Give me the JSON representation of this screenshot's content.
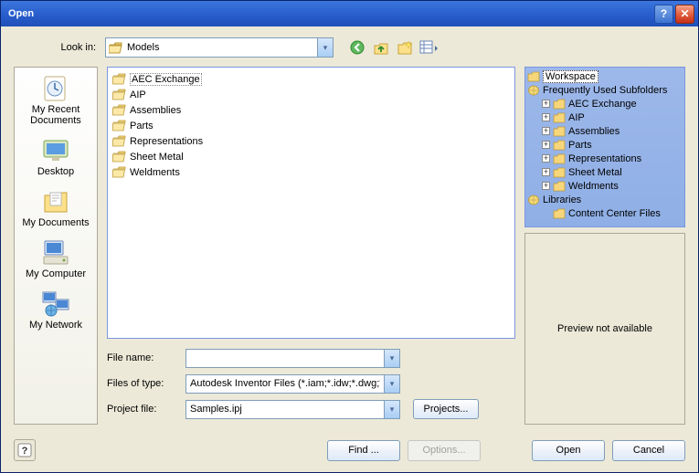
{
  "window": {
    "title": "Open"
  },
  "lookIn": {
    "label": "Look in:",
    "value": "Models"
  },
  "fileList": [
    {
      "name": "AEC Exchange",
      "selected": true
    },
    {
      "name": "AIP"
    },
    {
      "name": "Assemblies"
    },
    {
      "name": "Parts"
    },
    {
      "name": "Representations"
    },
    {
      "name": "Sheet Metal"
    },
    {
      "name": "Weldments"
    }
  ],
  "places": [
    {
      "label": "My Recent Documents"
    },
    {
      "label": "Desktop"
    },
    {
      "label": "My Documents"
    },
    {
      "label": "My Computer"
    },
    {
      "label": "My Network"
    }
  ],
  "fields": {
    "fileNameLabel": "File name:",
    "fileNameValue": "",
    "fileTypeLabel": "Files of type:",
    "fileTypeValue": "Autodesk Inventor Files (*.iam;*.idw;*.dwg;*.ipt;",
    "projectLabel": "Project file:",
    "projectValue": "Samples.ipj",
    "projectsBtn": "Projects..."
  },
  "tree": {
    "workspace": "Workspace",
    "frequently": "Frequently Used Subfolders",
    "items": [
      "AEC Exchange",
      "AIP",
      "Assemblies",
      "Parts",
      "Representations",
      "Sheet Metal",
      "Weldments"
    ],
    "libraries": "Libraries",
    "ccf": "Content Center Files"
  },
  "preview": {
    "text": "Preview not available"
  },
  "footer": {
    "find": "Find ...",
    "options": "Options...",
    "open": "Open",
    "cancel": "Cancel"
  }
}
